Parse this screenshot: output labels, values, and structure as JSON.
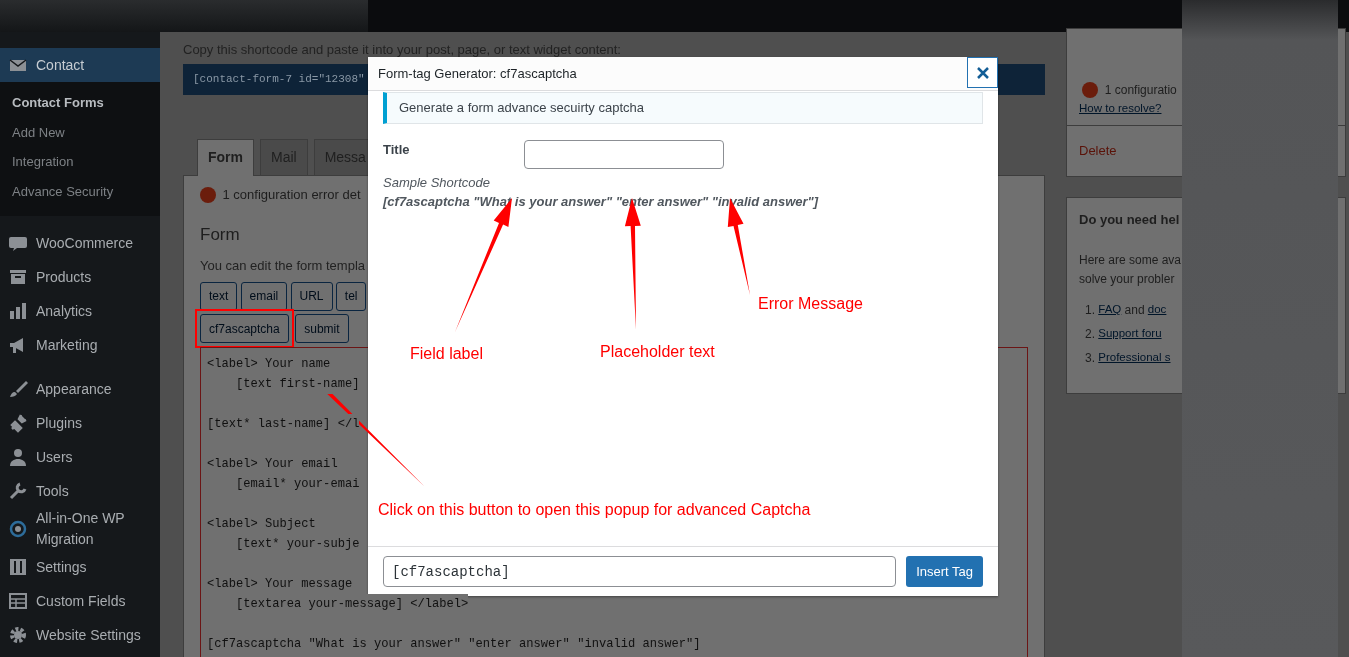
{
  "sidebar": {
    "sections": [
      [
        {
          "label": "Contact",
          "selected": true,
          "children": [
            {
              "label": "Contact Forms",
              "selected": true
            },
            {
              "label": "Add New",
              "selected": false
            },
            {
              "label": "Integration",
              "selected": false
            },
            {
              "label": "Advance Security",
              "selected": false
            }
          ]
        }
      ],
      [
        {
          "label": "WooCommerce",
          "selected": false
        },
        {
          "label": "Products",
          "selected": false
        },
        {
          "label": "Analytics",
          "selected": false
        },
        {
          "label": "Marketing",
          "selected": false
        }
      ],
      [
        {
          "label": "Appearance",
          "selected": false
        },
        {
          "label": "Plugins",
          "selected": false
        },
        {
          "label": "Users",
          "selected": false
        },
        {
          "label": "Tools",
          "selected": false
        },
        {
          "label": "All-in-One WP Migration",
          "selected": false
        },
        {
          "label": "Settings",
          "selected": false
        },
        {
          "label": "Custom Fields",
          "selected": false
        },
        {
          "label": "Website Settings",
          "selected": false
        }
      ]
    ]
  },
  "shortcode": {
    "hint": "Copy this shortcode and paste it into your post, page, or text widget content:",
    "code": "[contact-form-7 id=\"12308\""
  },
  "tabs": [
    {
      "label": "Form",
      "selected": true
    },
    {
      "label": "Mail",
      "selected": false
    },
    {
      "label": "Messa",
      "selected": false
    }
  ],
  "form_panel": {
    "notice": "1 configuration error det",
    "heading": "Form",
    "description": "You can edit the form templa",
    "tag_buttons": [
      {
        "label": "text",
        "highlighted": false
      },
      {
        "label": "email",
        "highlighted": false
      },
      {
        "label": "URL",
        "highlighted": false
      },
      {
        "label": "tel",
        "highlighted": false
      },
      {
        "label": "cf7ascaptcha",
        "highlighted": true
      },
      {
        "label": "submit",
        "highlighted": false
      }
    ],
    "code_blocks": [
      [
        "<label> Your name",
        "    [text first-name]"
      ],
      [
        "[text* last-name] </l"
      ],
      [
        "<label> Your email",
        "    [email* your-emai"
      ],
      [
        "<label> Subject",
        "    [text* your-subje"
      ],
      [
        "<label> Your message",
        "    [textarea your-message] </label>"
      ],
      [
        "[cf7ascaptcha \"What is your answer\" \"enter answer\" \"invalid answer\"]"
      ]
    ]
  },
  "side_card": {
    "notice": "1 configuratio",
    "link": "How to resolve?",
    "delete": "Delete"
  },
  "help_card": {
    "heading": "Do you need hel",
    "lines": [
      "Here are some ava",
      "solve your probler"
    ],
    "items": [
      {
        "number": "1.",
        "parts": [
          {
            "text": "FAQ",
            "link": true
          },
          {
            "text": "and",
            "link": false
          },
          {
            "text": "doc",
            "link": true
          }
        ]
      },
      {
        "number": "2.",
        "parts": [
          {
            "text": "Support foru",
            "link": true
          }
        ]
      },
      {
        "number": "3.",
        "parts": [
          {
            "text": "Professional s",
            "link": true
          }
        ]
      }
    ]
  },
  "modal": {
    "title": "Form-tag Generator: cf7ascaptcha",
    "info": "Generate a form advance secuirty captcha",
    "field_label": "Title",
    "sample_label": "Sample Shortcode",
    "sample": "[cf7ascaptcha \"What is your answer\" \"enter answer\" \"invalid answer\"]",
    "tag_value": "[cf7ascaptcha]",
    "insert_button": "Insert Tag"
  },
  "annotations": [
    {
      "text": "Field label"
    },
    {
      "text": "Placeholder text"
    },
    {
      "text": "Error Message"
    },
    {
      "text": "Click on this button to open this popup for advanced Captcha"
    }
  ]
}
